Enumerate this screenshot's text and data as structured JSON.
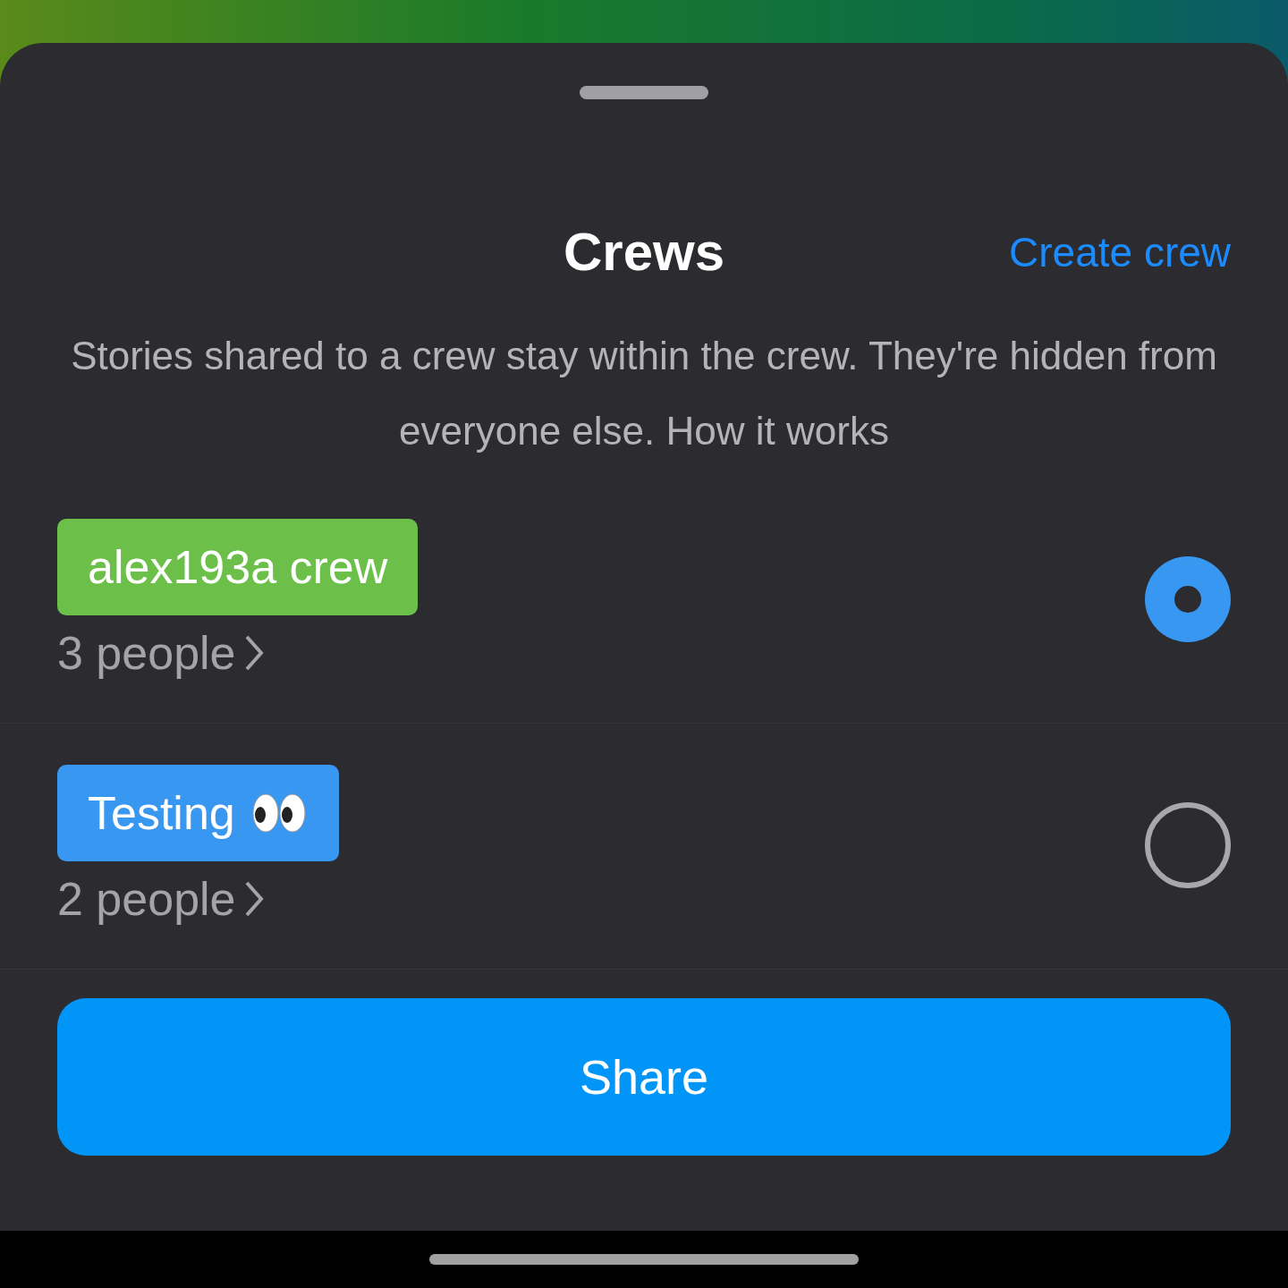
{
  "sheet": {
    "title": "Crews",
    "action": "Create crew",
    "description": "Stories shared to a crew stay within the crew. They're hidden from everyone else. How it works"
  },
  "crews": [
    {
      "name": "alex193a crew",
      "emoji": false,
      "color": "#6cc04a",
      "members": "3 people",
      "selected": true
    },
    {
      "name": "Testing",
      "emoji": true,
      "color": "#3897f0",
      "members": "2 people",
      "selected": false
    }
  ],
  "button": "Share"
}
